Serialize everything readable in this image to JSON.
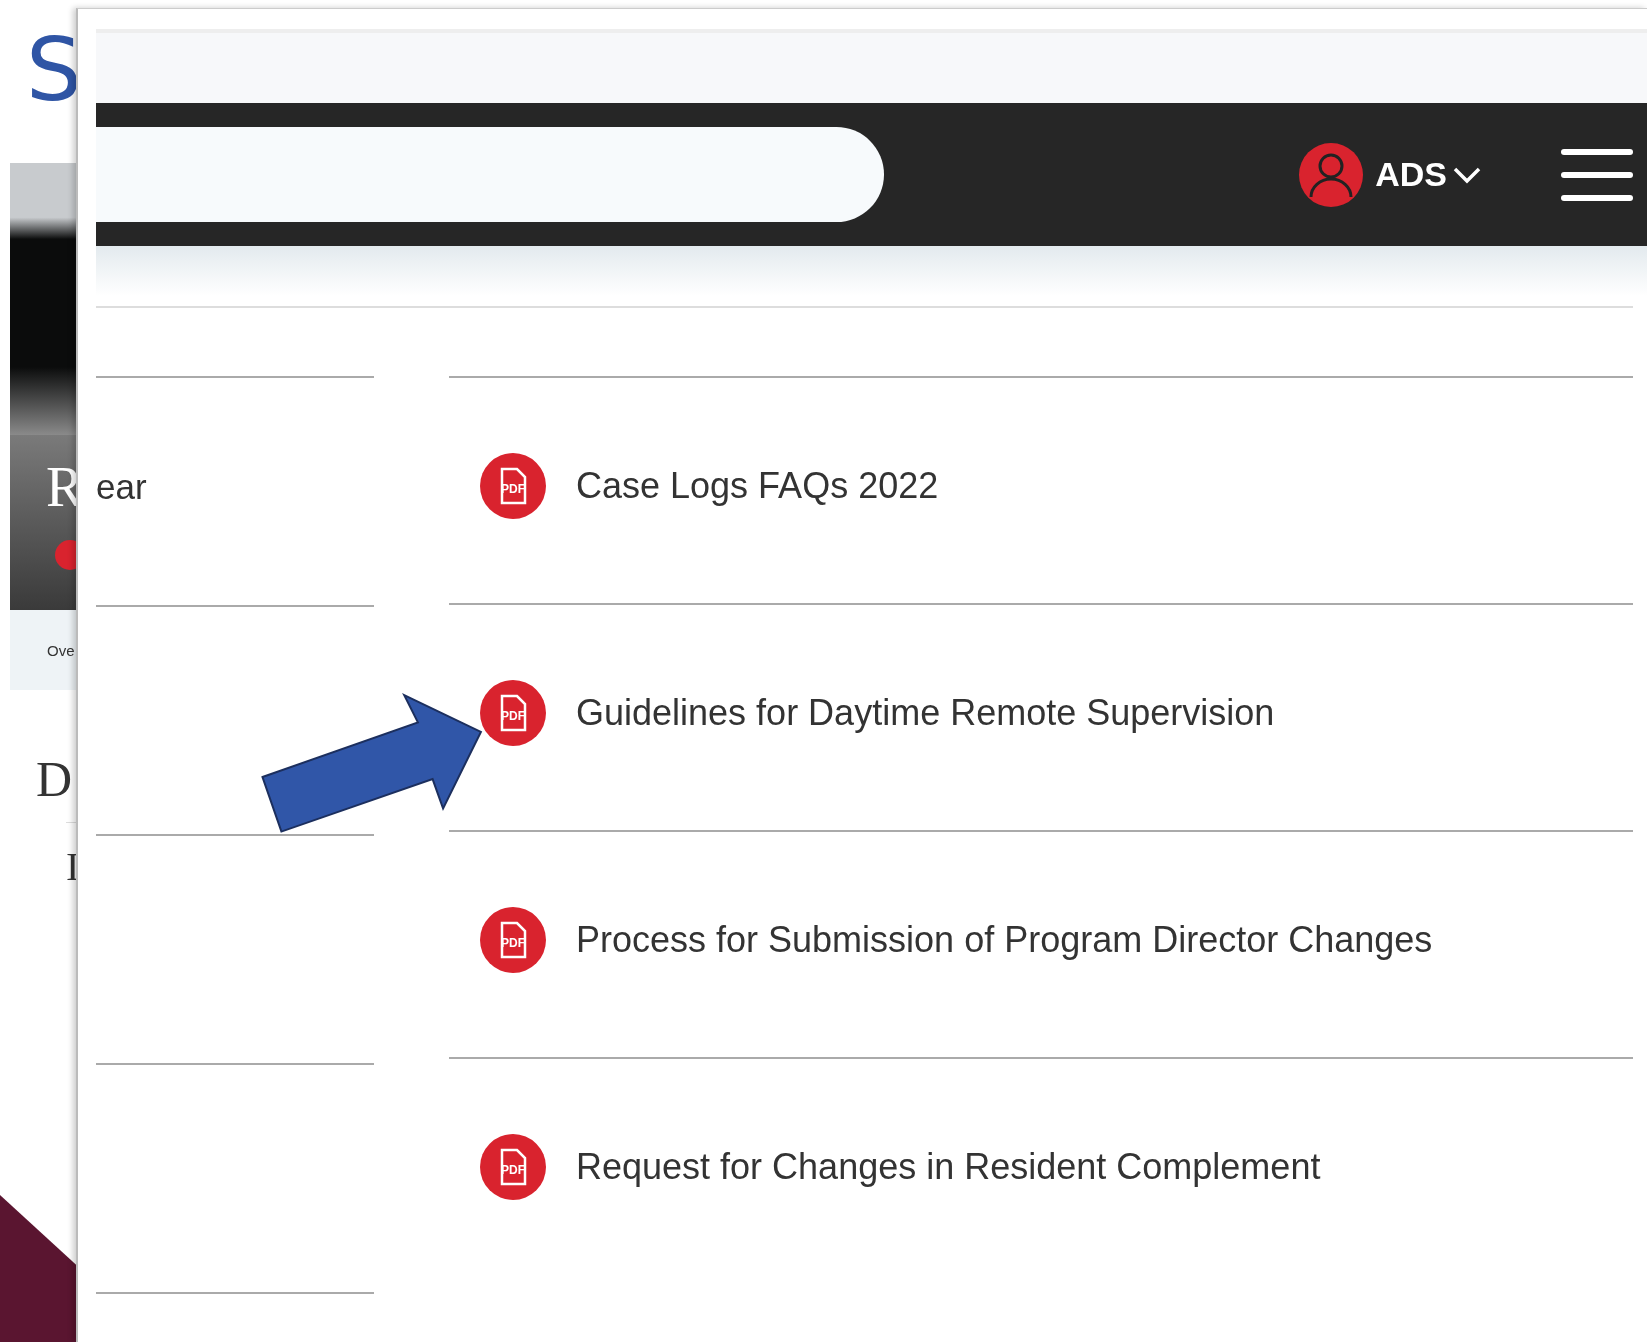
{
  "slide": {
    "title_fragment": "S"
  },
  "background_page": {
    "hero_letter": "R",
    "tab_fragment": "Ove",
    "heading_letter": "D",
    "text_letter": "I"
  },
  "header": {
    "user": "ADS"
  },
  "left_column": {
    "fragment": "ear"
  },
  "documents": [
    {
      "title": "Case Logs FAQs 2022",
      "icon_text": "PDF"
    },
    {
      "title": "Guidelines for Daytime Remote Supervision",
      "icon_text": "PDF"
    },
    {
      "title": "Process for Submission of Program Director Changes",
      "icon_text": "PDF"
    },
    {
      "title": "Request for Changes in Resident Complement",
      "icon_text": "PDF"
    }
  ]
}
